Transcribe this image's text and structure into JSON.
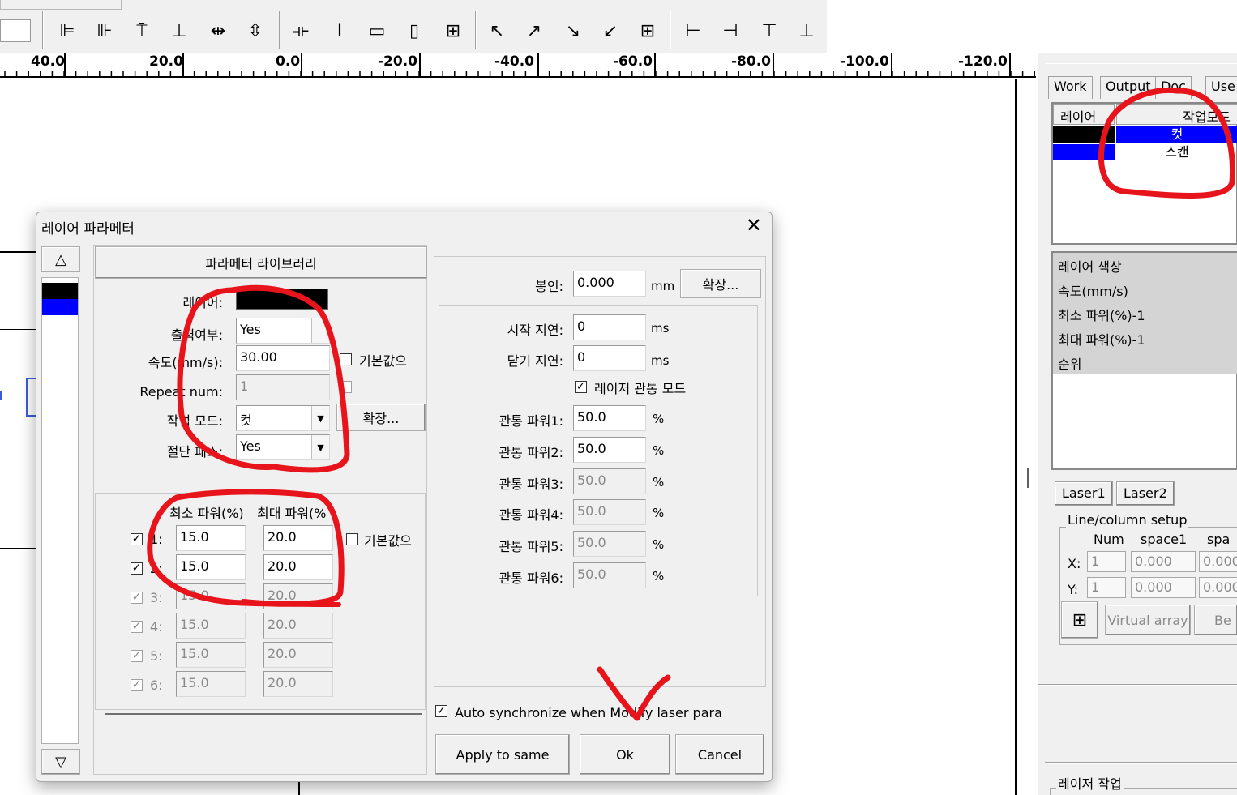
{
  "toolbar": {
    "icons": [
      "align-left-icon",
      "align-right-icon",
      "align-top-icon",
      "align-bottom-icon",
      "center-horizontal-icon",
      "center-vertical-icon",
      "same-width-icon",
      "same-height-icon",
      "same-size-h-icon",
      "same-size-v-icon",
      "grid-icon",
      "anchor-top-left-icon",
      "anchor-top-right-icon",
      "anchor-bottom-right-icon",
      "anchor-bottom-left-icon",
      "anchor-center-icon",
      "move-left-icon",
      "move-right-icon",
      "move-up-icon",
      "move-down-icon"
    ]
  },
  "ruler": {
    "labels": [
      "40.0",
      "20.0",
      "0.0",
      "-20.0",
      "-40.0",
      "-60.0",
      "-80.0",
      "-100.0",
      "-120.0"
    ]
  },
  "right_panel": {
    "tabs": [
      "Work",
      "Output",
      "Doc",
      "Use"
    ],
    "layer_table": {
      "headers": [
        "레이어",
        "작업모드"
      ],
      "rows": [
        {
          "mode": "컷",
          "color": "#000000"
        },
        {
          "mode": "스캔",
          "color": "#0000ff"
        }
      ]
    },
    "properties": [
      "레이어 색상",
      "속도(mm/s)",
      "최소 파워(%)-1",
      "최대 파워(%)-1",
      "순위"
    ],
    "laser_tabs": [
      "Laser1",
      "Laser2"
    ],
    "line_column": {
      "legend": "Line/column setup",
      "headers": [
        "Num",
        "space1",
        "spa"
      ],
      "x_label": "X:",
      "y_label": "Y:",
      "x_values": [
        "1",
        "0.000",
        "0.000"
      ],
      "y_values": [
        "1",
        "0.000",
        "0.000"
      ]
    },
    "virtual_array_label": "Virtual array",
    "be_label": "Be",
    "laser_work_label": "레이저 작업"
  },
  "dialog": {
    "title": "레이어 파라메터",
    "library_button": "파라메터 라이브러리",
    "layer_label": "레이어:",
    "layer_color": "#000000",
    "output_label": "출력여부:",
    "output_value": "Yes",
    "speed_label": "속도(mm/s):",
    "speed_value": "30.00",
    "default_label": "기본값으",
    "repeat_label": "Repeat num:",
    "repeat_value": "1",
    "work_mode_label": "작업 모드:",
    "work_mode_value": "컷",
    "expand_label": "확장...",
    "cut_pass_label": "절단 패스:",
    "cut_pass_value": "Yes",
    "min_power_header": "최소 파워(%)",
    "max_power_header": "최대 파워(%",
    "power_default_label": "기본값으",
    "power_rows": [
      {
        "label": "1:",
        "min": "15.0",
        "max": "20.0",
        "checked": true,
        "enabled": true
      },
      {
        "label": "2:",
        "min": "15.0",
        "max": "20.0",
        "checked": true,
        "enabled": true
      },
      {
        "label": "3:",
        "min": "15.0",
        "max": "20.0",
        "checked": true,
        "enabled": false
      },
      {
        "label": "4:",
        "min": "15.0",
        "max": "20.0",
        "checked": true,
        "enabled": false
      },
      {
        "label": "5:",
        "min": "15.0",
        "max": "20.0",
        "checked": true,
        "enabled": false
      },
      {
        "label": "6:",
        "min": "15.0",
        "max": "20.0",
        "checked": true,
        "enabled": false
      }
    ],
    "seal_label": "봉인:",
    "seal_value": "0.000",
    "seal_unit": "mm",
    "seal_expand": "확장...",
    "start_delay_label": "시작 지연:",
    "start_delay_value": "0",
    "close_delay_label": "닫기 지연:",
    "close_delay_value": "0",
    "ms": "ms",
    "pierce_mode_label": "레이저 관통 모드",
    "pierce_rows": [
      {
        "label": "관통 파워1:",
        "value": "50.0",
        "enabled": true
      },
      {
        "label": "관통 파워2:",
        "value": "50.0",
        "enabled": true
      },
      {
        "label": "관통 파워3:",
        "value": "50.0",
        "enabled": false
      },
      {
        "label": "관통 파워4:",
        "value": "50.0",
        "enabled": false
      },
      {
        "label": "관통 파워5:",
        "value": "50.0",
        "enabled": false
      },
      {
        "label": "관통 파워6:",
        "value": "50.0",
        "enabled": false
      }
    ],
    "percent": "%",
    "auto_sync_label": "Auto synchronize when Modify laser para",
    "apply_button": "Apply to same",
    "ok_button": "Ok",
    "cancel_button": "Cancel"
  },
  "colors": {
    "annotation": "#e8141b",
    "selection": "#0000ff"
  }
}
